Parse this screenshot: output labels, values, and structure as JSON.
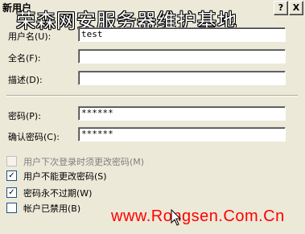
{
  "window": {
    "title": "新用户",
    "help_button": "?",
    "close_button": "X"
  },
  "watermark": "荣森网安服务器维护基地",
  "form": {
    "username": {
      "label": "用户名(U):",
      "value": "test"
    },
    "fullname": {
      "label": "全名(F):",
      "value": ""
    },
    "description": {
      "label": "描述(D):",
      "value": ""
    },
    "password": {
      "label": "密码(P):",
      "value": "******"
    },
    "confirm_password": {
      "label": "确认密码(C):",
      "value": "******"
    }
  },
  "options": [
    {
      "label": "用户下次登录时须更改密码(M)",
      "checked": false,
      "disabled": true
    },
    {
      "label": "用户不能更改密码(S)",
      "checked": true,
      "disabled": false
    },
    {
      "label": "密码永不过期(W)",
      "checked": true,
      "disabled": false
    },
    {
      "label": "帐户已禁用(B)",
      "checked": false,
      "disabled": false
    }
  ],
  "footer_watermark": "www.Rongsen.Com.Cn"
}
